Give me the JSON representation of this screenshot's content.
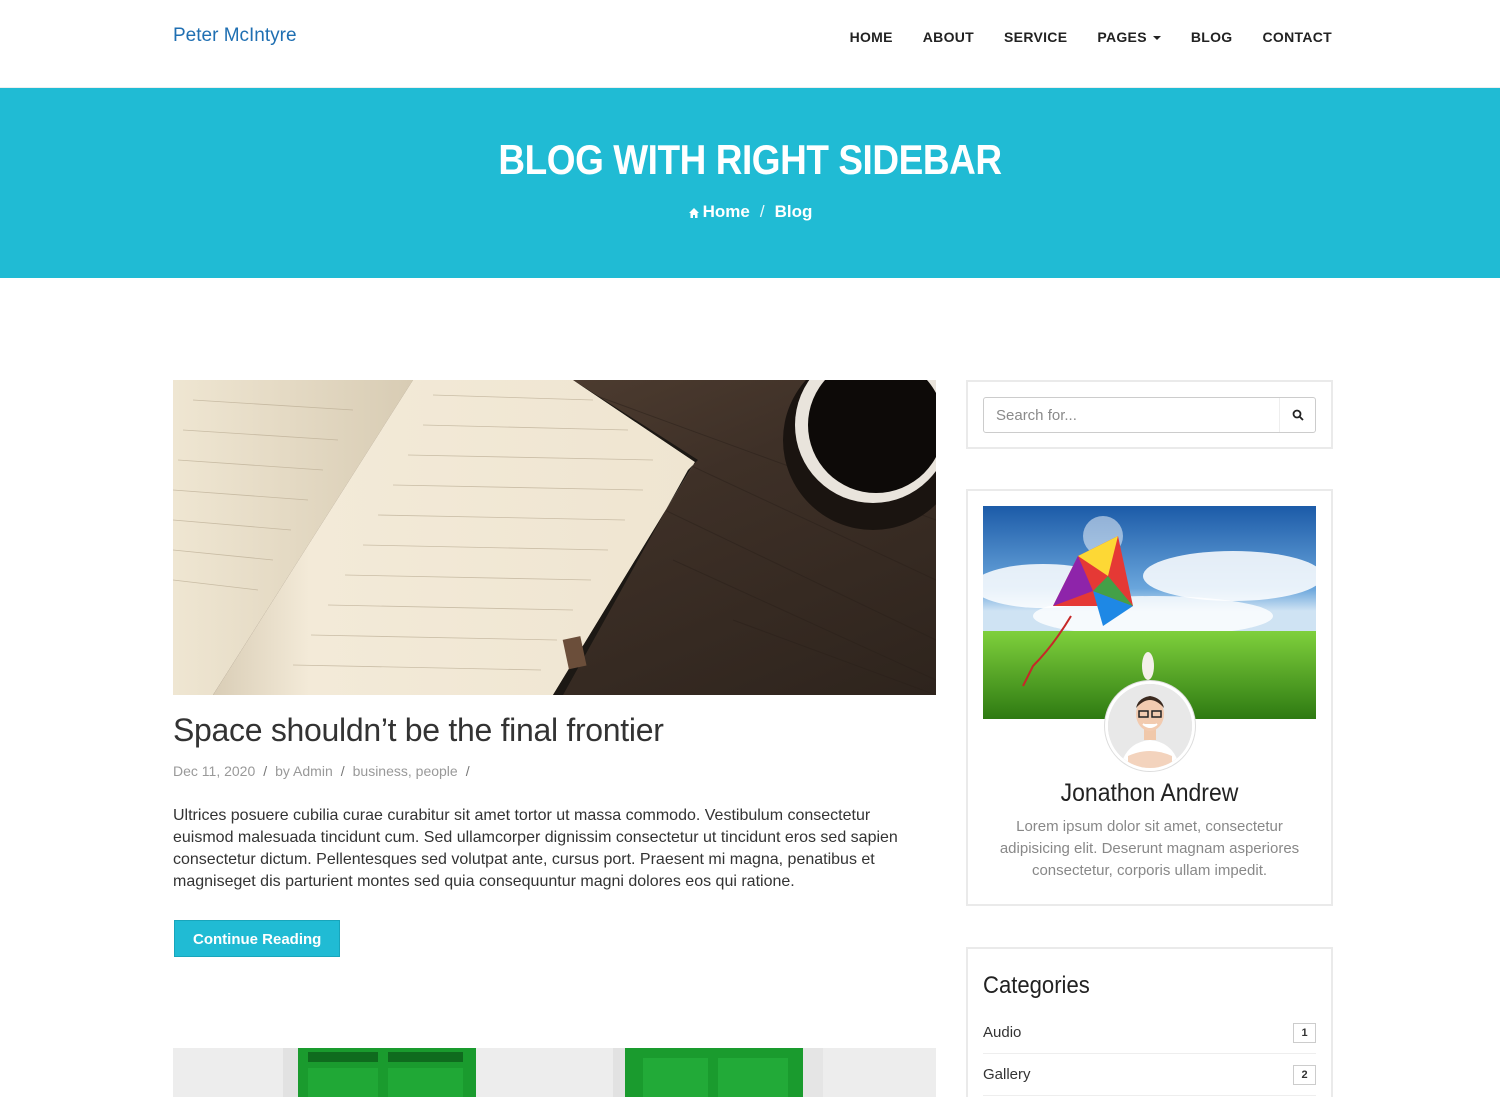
{
  "navbar": {
    "brand": "Peter McIntyre",
    "items": [
      {
        "label": "HOME"
      },
      {
        "label": "ABOUT"
      },
      {
        "label": "SERVICE"
      },
      {
        "label": "PAGES"
      },
      {
        "label": "BLOG"
      },
      {
        "label": "CONTACT"
      }
    ]
  },
  "hero": {
    "title": "BLOG WITH RIGHT SIDEBAR",
    "breadcrumb": [
      {
        "label": "Home",
        "icon": "home-icon"
      },
      {
        "label": "Blog"
      }
    ],
    "background_color": "#20bbd4"
  },
  "post": {
    "title": "Space shouldn’t be the final frontier",
    "date": "Dec 11, 2020",
    "author": "by Admin",
    "tags": "business, people",
    "body": "Ultrices posuere cubilia curae curabitur sit amet tortor ut massa commodo. Vestibulum consectetur euismod malesuada tincidunt cum. Sed ullamcorper dignissim consectetur ut tincidunt eros sed sapien consectetur dictum. Pellentesques sed volutpat ante, cursus port. Praesent mi magna, penatibus et magniseget dis parturient montes sed quia consequuntur magni dolores eos qui ratione.",
    "button": "Continue Reading"
  },
  "sidebar": {
    "search": {
      "placeholder": "Search for...",
      "icon": "search-icon"
    },
    "profile": {
      "name": "Jonathon Andrew",
      "bio": "Lorem ipsum dolor sit amet, consectetur adipisicing elit. Deserunt magnam asperiores consectetur, corporis ullam impedit."
    },
    "categories": {
      "title": "Categories",
      "items": [
        {
          "label": "Audio",
          "count": "1"
        },
        {
          "label": "Gallery",
          "count": "2"
        }
      ]
    }
  }
}
